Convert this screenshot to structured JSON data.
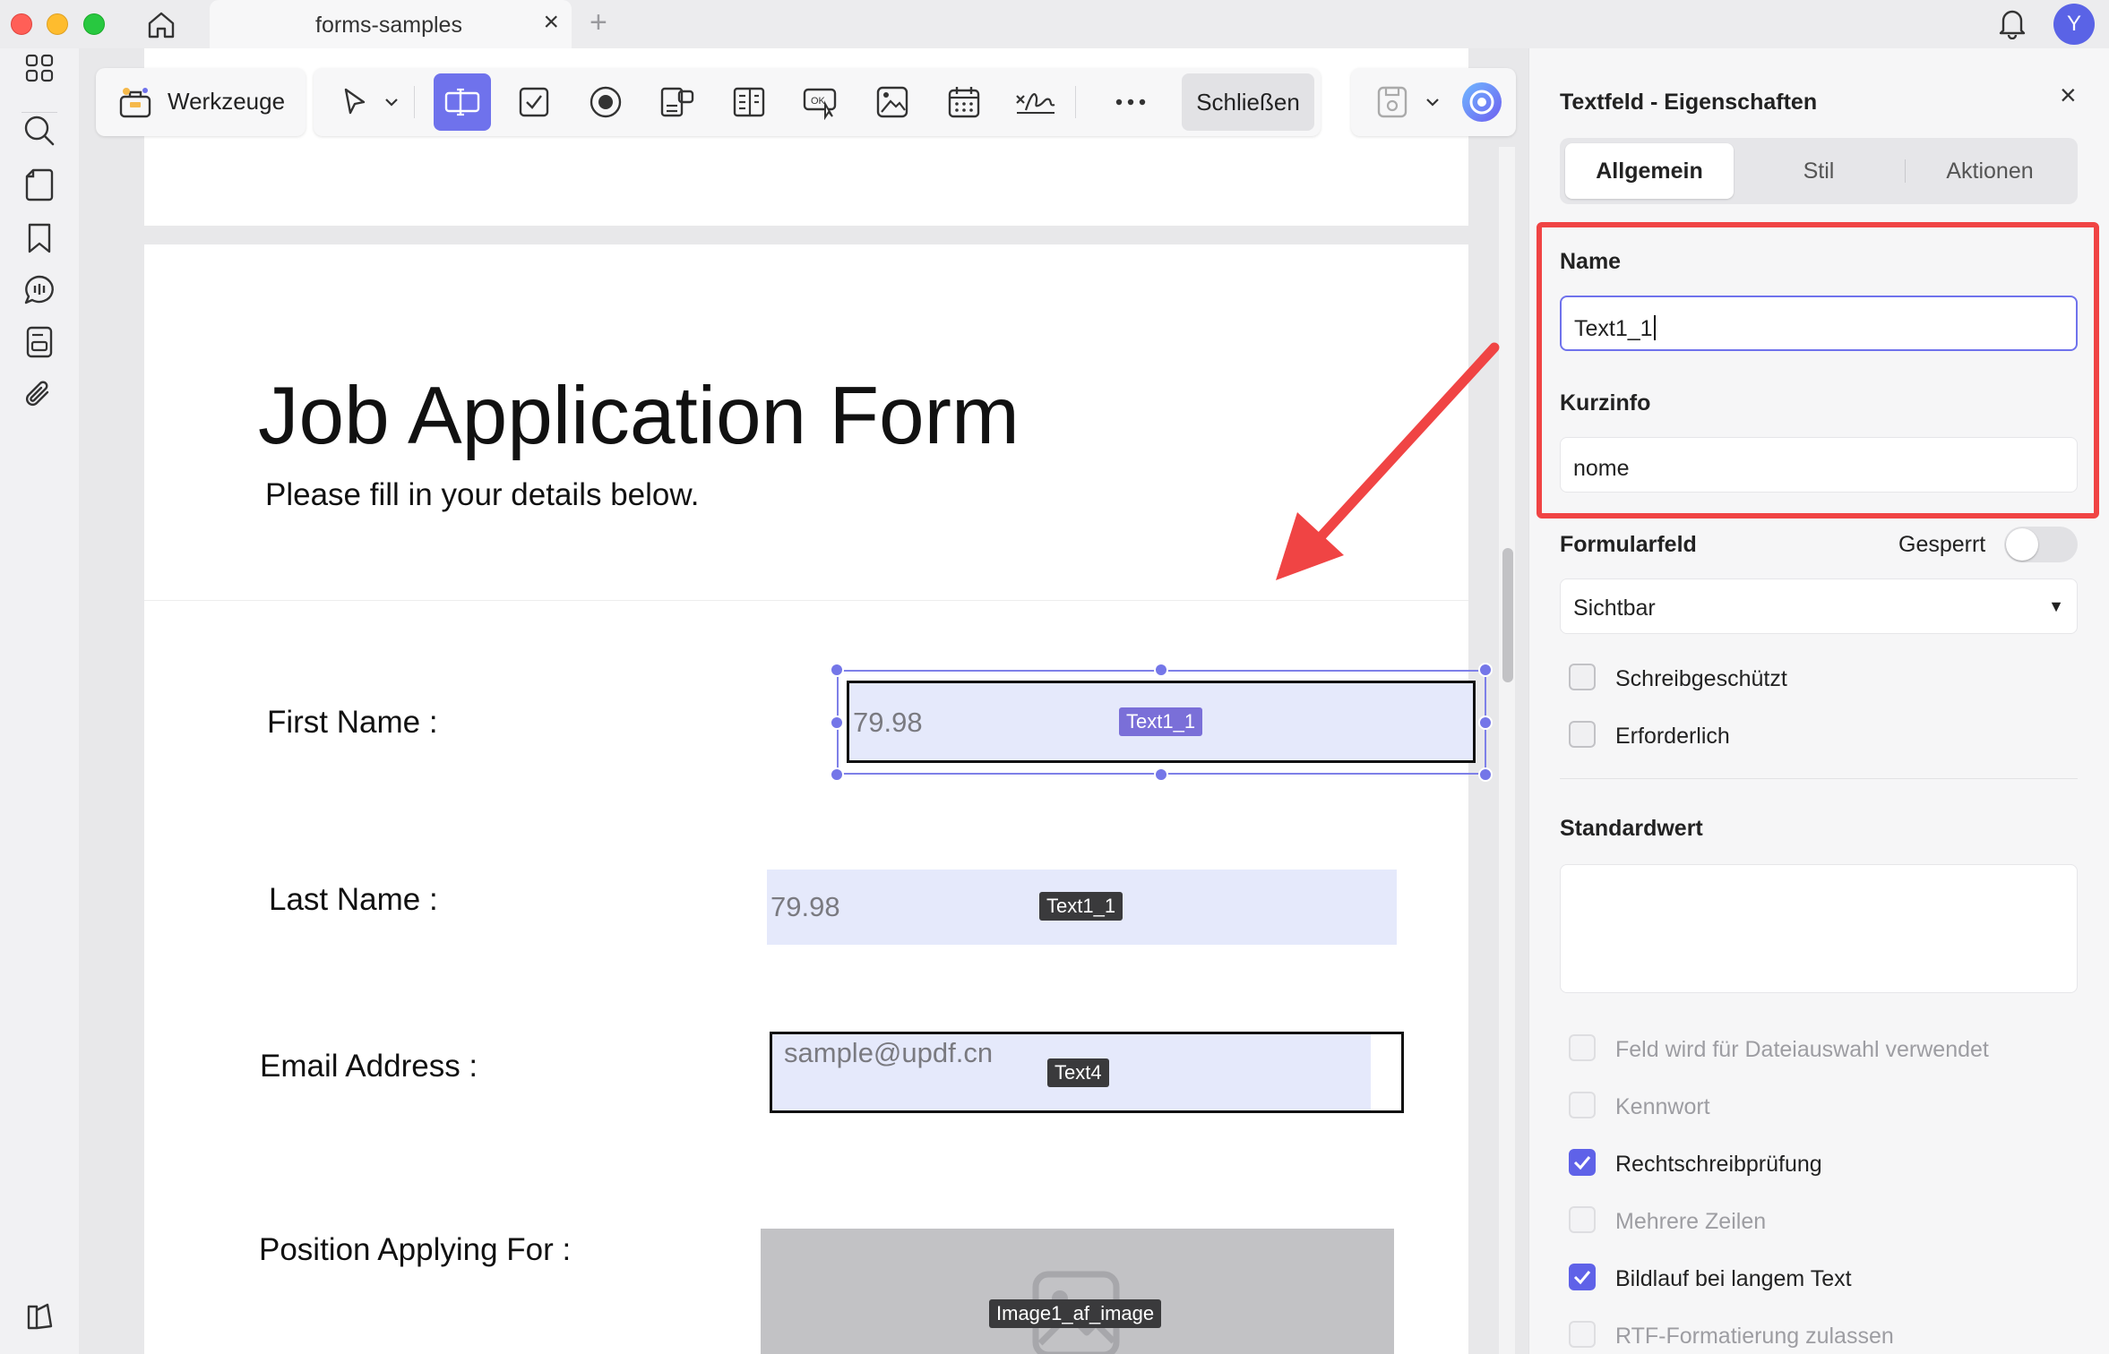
{
  "window": {
    "tab_title": "forms-samples",
    "avatar_initial": "Y"
  },
  "toolbar": {
    "tools_label": "Werkzeuge",
    "close_label": "Schließen"
  },
  "document": {
    "title": "Job Application Form",
    "subtitle": "Please fill in your details below.",
    "fields": [
      {
        "label": "First Name :",
        "value": "79.98",
        "tag": "Text1_1",
        "selected": true
      },
      {
        "label": "Last Name :",
        "value": "79.98",
        "tag": "Text1_1",
        "selected": false
      },
      {
        "label": "Email Address :",
        "value": "sample@updf.cn",
        "tag": "Text4",
        "selected": false
      },
      {
        "label": "Position Applying For :",
        "value": "",
        "tag": "Image1_af_image",
        "selected": false
      }
    ]
  },
  "panel": {
    "title": "Textfeld - Eigenschaften",
    "tabs": [
      "Allgemein",
      "Stil",
      "Aktionen"
    ],
    "active_tab": "Allgemein",
    "name_label": "Name",
    "name_value": "Text1_1",
    "tooltip_label": "Kurzinfo",
    "tooltip_value": "nome",
    "form_field_label": "Formularfeld",
    "locked_label": "Gesperrt",
    "locked": false,
    "visibility_value": "Sichtbar",
    "default_label": "Standardwert",
    "default_value": "",
    "checkboxes": [
      {
        "label": "Schreibgeschützt",
        "checked": false,
        "enabled": true
      },
      {
        "label": "Erforderlich",
        "checked": false,
        "enabled": true
      },
      {
        "label": "Feld wird für Dateiauswahl verwendet",
        "checked": false,
        "enabled": false
      },
      {
        "label": "Kennwort",
        "checked": false,
        "enabled": false
      },
      {
        "label": "Rechtschreibprüfung",
        "checked": true,
        "enabled": true
      },
      {
        "label": "Mehrere Zeilen",
        "checked": false,
        "enabled": false
      },
      {
        "label": "Bildlauf bei langem Text",
        "checked": true,
        "enabled": true
      },
      {
        "label": "RTF-Formatierung zulassen",
        "checked": false,
        "enabled": false
      }
    ]
  },
  "colors": {
    "accent": "#6f72ec",
    "annotation_red": "#f04444",
    "field_fill": "#e5e9fb"
  },
  "icons": [
    "home-icon",
    "bell-icon",
    "grid-icon",
    "search-icon",
    "page-icon",
    "bookmark-icon",
    "comment-icon",
    "form-icon",
    "attachment-icon",
    "sidebar-toggle-icon",
    "toolbox-icon",
    "pointer-icon",
    "text-field-icon",
    "checkbox-icon",
    "radio-icon",
    "combo-box-icon",
    "list-box-icon",
    "push-button-icon",
    "image-field-icon",
    "date-field-icon",
    "signature-field-icon",
    "more-icon",
    "save-icon",
    "ai-assistant-icon"
  ]
}
